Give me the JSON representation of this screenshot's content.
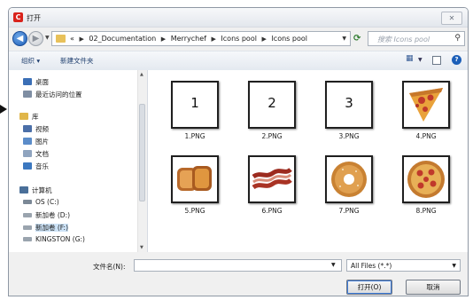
{
  "window": {
    "title": "打开",
    "close": "✕"
  },
  "nav": {
    "back_icon": "back-arrow-icon",
    "forward_icon": "forward-arrow-icon",
    "breadcrumbs": [
      "«",
      "02_Documentation",
      "Merrychef",
      "Icons pool",
      "Icons pool"
    ],
    "search_placeholder": "搜索 Icons pool"
  },
  "toolbar": {
    "organize": "组织 ▾",
    "new_folder": "新建文件夹"
  },
  "sidebar": {
    "items": [
      {
        "label": "桌面",
        "icon": "desktop-icon",
        "color": "#3b6fb6"
      },
      {
        "label": "最近访问的位置",
        "icon": "recent-places-icon",
        "color": "#7f8ea3"
      },
      {
        "label": "库",
        "icon": "libraries-icon",
        "color": "#e0b64a"
      },
      {
        "label": "视频",
        "icon": "videos-icon",
        "color": "#4b6fa8"
      },
      {
        "label": "图片",
        "icon": "pictures-icon",
        "color": "#5b8cc9"
      },
      {
        "label": "文档",
        "icon": "documents-icon",
        "color": "#8fa4bf"
      },
      {
        "label": "音乐",
        "icon": "music-icon",
        "color": "#3c78c0"
      },
      {
        "label": "计算机",
        "icon": "computer-icon",
        "color": "#4a6f99"
      },
      {
        "label": "OS (C:)",
        "icon": "drive-icon",
        "color": "#7b8896"
      },
      {
        "label": "新加卷 (D:)",
        "icon": "drive-icon",
        "color": "#9aa4ae"
      },
      {
        "label": "新加卷 (F:)",
        "icon": "drive-icon",
        "color": "#9aa4ae"
      },
      {
        "label": "KINGSTON (G:)",
        "icon": "usb-drive-icon",
        "color": "#9aa4ae"
      }
    ]
  },
  "files": [
    {
      "name": "1.PNG",
      "thumb": "1",
      "kind": "number"
    },
    {
      "name": "2.PNG",
      "thumb": "2",
      "kind": "number"
    },
    {
      "name": "3.PNG",
      "thumb": "3",
      "kind": "number"
    },
    {
      "name": "4.PNG",
      "kind": "pizza-slice-icon"
    },
    {
      "name": "5.PNG",
      "kind": "toast-icon"
    },
    {
      "name": "6.PNG",
      "kind": "bacon-icon"
    },
    {
      "name": "7.PNG",
      "kind": "bagel-icon"
    },
    {
      "name": "8.PNG",
      "kind": "pizza-icon"
    }
  ],
  "footer": {
    "filename_label": "文件名(N):",
    "filename_value": "",
    "filetype": "All Files (*.*)",
    "open_label": "打开(O)",
    "cancel_label": "取消"
  }
}
